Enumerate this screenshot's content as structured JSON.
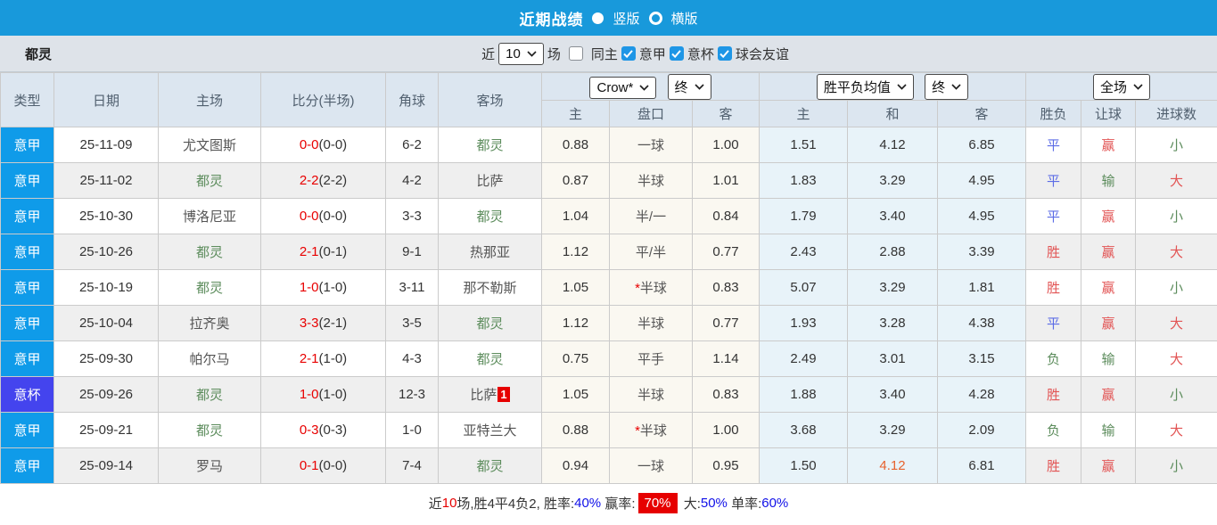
{
  "titlebar": {
    "title": "近期战绩",
    "radio_vertical": "竖版",
    "radio_horizontal": "横版"
  },
  "filterbar": {
    "team": "都灵",
    "recent_prefix": "近",
    "recent_count": "10",
    "recent_suffix": "场",
    "checkbox_same_home": "同主",
    "checkbox_serie_a": "意甲",
    "checkbox_italy_cup": "意杯",
    "checkbox_friendly": "球会友谊"
  },
  "table": {
    "columns": {
      "type": "类型",
      "date": "日期",
      "home": "主场",
      "score": "比分(半场)",
      "corners": "角球",
      "away": "客场",
      "asia_home": "主",
      "asia_line": "盘口",
      "asia_away": "客",
      "euro_home": "主",
      "euro_draw": "和",
      "euro_away": "客",
      "result": "胜负",
      "handicap": "让球",
      "goals": "进球数"
    },
    "selects": {
      "bookmaker": "Crow*",
      "asia_time": "终",
      "euro_label": "胜平负均值",
      "euro_time": "终",
      "scope": "全场"
    },
    "rows": [
      {
        "type": "意甲",
        "date": "25-11-09",
        "home": "尤文图斯",
        "score_ft": "0-0",
        "score_ht": "(0-0)",
        "corners": "6-2",
        "away": "都灵",
        "away_badge": "",
        "asia_home": "0.88",
        "line_star": "",
        "line": "一球",
        "asia_away": "1.00",
        "euro_home": "1.51",
        "euro_draw": "4.12",
        "euro_away": "6.85",
        "result": "平",
        "handicap": "赢",
        "goals": "小"
      },
      {
        "type": "意甲",
        "date": "25-11-02",
        "home": "都灵",
        "score_ft": "2-2",
        "score_ht": "(2-2)",
        "corners": "4-2",
        "away": "比萨",
        "away_badge": "",
        "asia_home": "0.87",
        "line_star": "",
        "line": "半球",
        "asia_away": "1.01",
        "euro_home": "1.83",
        "euro_draw": "3.29",
        "euro_away": "4.95",
        "result": "平",
        "handicap": "输",
        "goals": "大"
      },
      {
        "type": "意甲",
        "date": "25-10-30",
        "home": "博洛尼亚",
        "score_ft": "0-0",
        "score_ht": "(0-0)",
        "corners": "3-3",
        "away": "都灵",
        "away_badge": "",
        "asia_home": "1.04",
        "line_star": "",
        "line": "半/一",
        "asia_away": "0.84",
        "euro_home": "1.79",
        "euro_draw": "3.40",
        "euro_away": "4.95",
        "result": "平",
        "handicap": "赢",
        "goals": "小"
      },
      {
        "type": "意甲",
        "date": "25-10-26",
        "home": "都灵",
        "score_ft": "2-1",
        "score_ht": "(0-1)",
        "corners": "9-1",
        "away": "热那亚",
        "away_badge": "",
        "asia_home": "1.12",
        "line_star": "",
        "line": "平/半",
        "asia_away": "0.77",
        "euro_home": "2.43",
        "euro_draw": "2.88",
        "euro_away": "3.39",
        "result": "胜",
        "handicap": "赢",
        "goals": "大"
      },
      {
        "type": "意甲",
        "date": "25-10-19",
        "home": "都灵",
        "score_ft": "1-0",
        "score_ht": "(1-0)",
        "corners": "3-11",
        "away": "那不勒斯",
        "away_badge": "",
        "asia_home": "1.05",
        "line_star": "*",
        "line": "半球",
        "asia_away": "0.83",
        "euro_home": "5.07",
        "euro_draw": "3.29",
        "euro_away": "1.81",
        "result": "胜",
        "handicap": "赢",
        "goals": "小"
      },
      {
        "type": "意甲",
        "date": "25-10-04",
        "home": "拉齐奥",
        "score_ft": "3-3",
        "score_ht": "(2-1)",
        "corners": "3-5",
        "away": "都灵",
        "away_badge": "",
        "asia_home": "1.12",
        "line_star": "",
        "line": "半球",
        "asia_away": "0.77",
        "euro_home": "1.93",
        "euro_draw": "3.28",
        "euro_away": "4.38",
        "result": "平",
        "handicap": "赢",
        "goals": "大"
      },
      {
        "type": "意甲",
        "date": "25-09-30",
        "home": "帕尔马",
        "score_ft": "2-1",
        "score_ht": "(1-0)",
        "corners": "4-3",
        "away": "都灵",
        "away_badge": "",
        "asia_home": "0.75",
        "line_star": "",
        "line": "平手",
        "asia_away": "1.14",
        "euro_home": "2.49",
        "euro_draw": "3.01",
        "euro_away": "3.15",
        "result": "负",
        "handicap": "输",
        "goals": "大"
      },
      {
        "type": "意杯",
        "date": "25-09-26",
        "home": "都灵",
        "score_ft": "1-0",
        "score_ht": "(1-0)",
        "corners": "12-3",
        "away": "比萨",
        "away_badge": "1",
        "asia_home": "1.05",
        "line_star": "",
        "line": "半球",
        "asia_away": "0.83",
        "euro_home": "1.88",
        "euro_draw": "3.40",
        "euro_away": "4.28",
        "result": "胜",
        "handicap": "赢",
        "goals": "小"
      },
      {
        "type": "意甲",
        "date": "25-09-21",
        "home": "都灵",
        "score_ft": "0-3",
        "score_ht": "(0-3)",
        "corners": "1-0",
        "away": "亚特兰大",
        "away_badge": "",
        "asia_home": "0.88",
        "line_star": "*",
        "line": "半球",
        "asia_away": "1.00",
        "euro_home": "3.68",
        "euro_draw": "3.29",
        "euro_away": "2.09",
        "result": "负",
        "handicap": "输",
        "goals": "大"
      },
      {
        "type": "意甲",
        "date": "25-09-14",
        "home": "罗马",
        "score_ft": "0-1",
        "score_ht": "(0-0)",
        "corners": "7-4",
        "away": "都灵",
        "away_badge": "",
        "asia_home": "0.94",
        "line_star": "",
        "line": "一球",
        "asia_away": "0.95",
        "euro_home": "1.50",
        "euro_draw": "4.12",
        "euro_away": "6.81",
        "result": "胜",
        "handicap": "赢",
        "goals": "小"
      }
    ]
  },
  "summary": {
    "seg1": "近",
    "seg2": "10",
    "seg3": "场,胜4平4负2, 胜率:",
    "seg4": "40%",
    "seg5": " 赢率:",
    "seg6": "70%",
    "seg7": " 大:",
    "seg8": "50%",
    "seg9": " 单率:",
    "seg10": "60%"
  },
  "colors": {
    "topbar_blue": "#1899DB",
    "league_blue": "#0F9BE9",
    "cup_purple": "#4444EE",
    "score_red": "#E80000",
    "team_green": "#5C8C5C",
    "result_red": "#E25454",
    "result_blue": "#5C6CE6",
    "result_green": "#5C8C5C",
    "draw_highlight_orange": "#E7622E",
    "summary_badge_red": "#E60000",
    "summary_blue": "#1010E8"
  }
}
